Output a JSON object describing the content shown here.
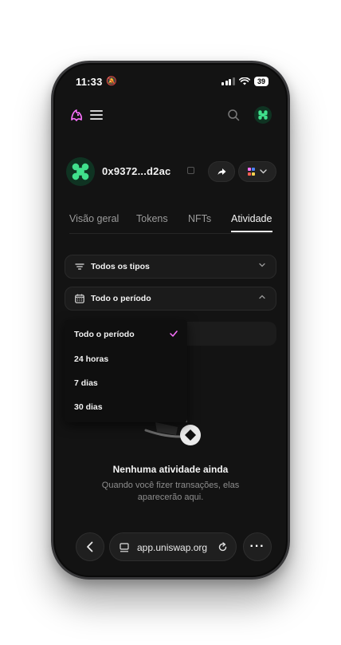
{
  "status_bar": {
    "time": "11:33",
    "battery": "39"
  },
  "wallet": {
    "address": "0x9372...d2ac"
  },
  "tabs": [
    {
      "label": "Visão geral"
    },
    {
      "label": "Tokens"
    },
    {
      "label": "NFTs"
    },
    {
      "label": "Atividade"
    }
  ],
  "filters": {
    "type_label": "Todos os tipos",
    "period_label": "Todo o período"
  },
  "period_options": [
    {
      "label": "Todo o período",
      "selected": true
    },
    {
      "label": "24 horas",
      "selected": false
    },
    {
      "label": "7 dias",
      "selected": false
    },
    {
      "label": "30 dias",
      "selected": false
    }
  ],
  "empty_state": {
    "title": "Nenhuma atividade ainda",
    "subtitle": "Quando você fizer transações, elas aparecerão aqui."
  },
  "browser": {
    "url": "app.uniswap.org"
  },
  "colors": {
    "accent": "#fc72ff",
    "avatar_green": "#40e08c",
    "background": "#131313"
  }
}
